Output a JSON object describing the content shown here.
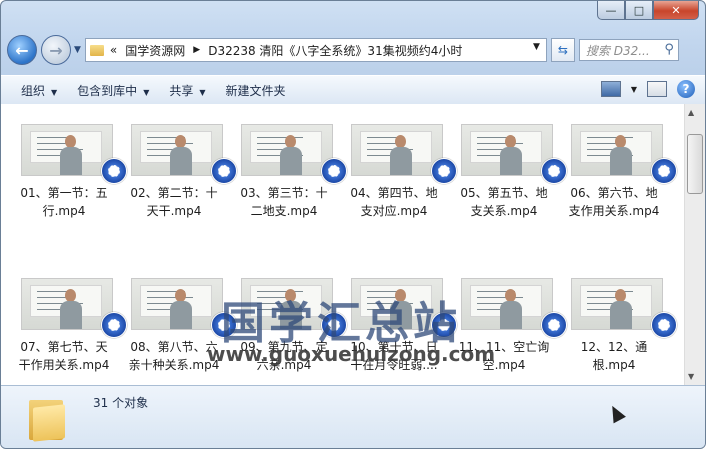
{
  "window": {
    "minimize": "—",
    "maximize": "□",
    "close": "✕"
  },
  "address": {
    "overflow": "«",
    "crumbs": [
      "国学资源网",
      "D32238 清阳《八字全系统》31集视频约4小时"
    ],
    "search_placeholder": "搜索 D32..."
  },
  "toolbar": {
    "organize": "组织",
    "include_library": "包含到库中",
    "share": "共享",
    "new_folder": "新建文件夹"
  },
  "files": [
    {
      "label": "01、第一节：五行.mp4"
    },
    {
      "label": "02、第二节：十天干.mp4"
    },
    {
      "label": "03、第三节：十二地支.mp4"
    },
    {
      "label": "04、第四节、地支对应.mp4"
    },
    {
      "label": "05、第五节、地支关系.mp4"
    },
    {
      "label": "06、第六节、地支作用关系.mp4"
    },
    {
      "label": "07、第七节、天干作用关系.mp4"
    },
    {
      "label": "08、第八节、六亲十种关系.mp4"
    },
    {
      "label": "09、第九节、定六亲.mp4"
    },
    {
      "label": "10、第十节、日干在月令旺弱...."
    },
    {
      "label": "11、11、空亡询空.mp4"
    },
    {
      "label": "12、12、通根.mp4"
    }
  ],
  "watermark": {
    "title": "国学汇总站",
    "url": "www.guoxuehuizong.com"
  },
  "status": {
    "count": "31 个对象"
  },
  "colors": {
    "accent": "#2d74c9",
    "toolbar_bg": "#dce7f4",
    "badge": "#1c48a6"
  }
}
